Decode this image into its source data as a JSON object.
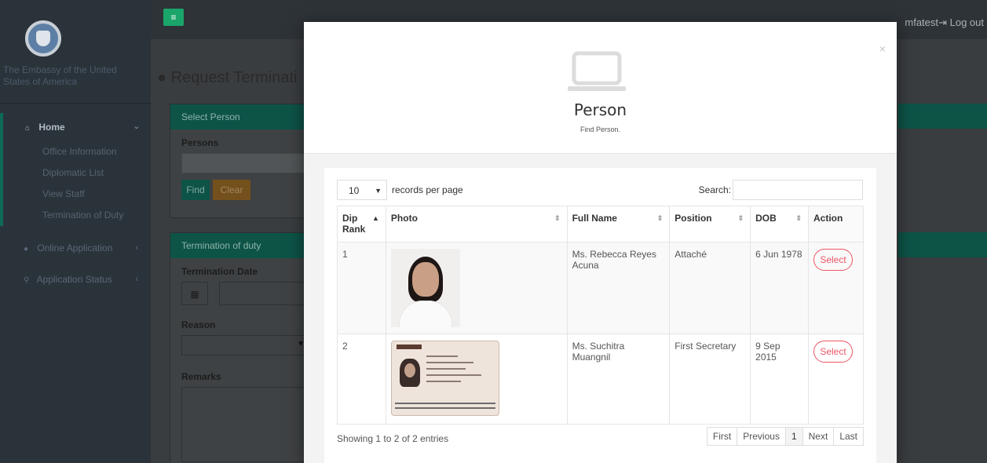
{
  "sidebar": {
    "brand_text": "The Embassy of the United States of America",
    "home_label": "Home",
    "home_items": [
      "Office Information",
      "Diplomatic List",
      "View Staff",
      "Termination of Duty"
    ],
    "online_application": "Online Application",
    "application_status": "Application Status"
  },
  "topbar": {
    "user": "mfatest",
    "logout": "Log out"
  },
  "page": {
    "title": "Request Terminati",
    "select_person_panel": "Select Person",
    "persons_label": "Persons",
    "find_button": "Find",
    "clear_button": "Clear",
    "termination_panel": "Termination of duty",
    "termination_date_label": "Termination Date",
    "reason_label": "Reason",
    "remarks_label": "Remarks"
  },
  "modal": {
    "close": "×",
    "icon": "laptop-icon",
    "title": "Person",
    "subtitle": "Find Person.",
    "length_value": "10",
    "length_suffix": "records per page",
    "search_label": "Search:",
    "columns": [
      "Dip Rank",
      "Photo",
      "Full Name",
      "Position",
      "DOB",
      "Action"
    ],
    "rows": [
      {
        "rank": "1",
        "full_name": "Ms. Rebecca Reyes Acuna",
        "position": "Attaché",
        "dob": "6 Jun 1978",
        "action": "Select"
      },
      {
        "rank": "2",
        "full_name": "Ms. Suchitra Muangnil",
        "position": "First Secretary",
        "dob": "9 Sep 2015",
        "action": "Select"
      }
    ],
    "info": "Showing 1 to 2 of 2 entries",
    "pager": [
      "First",
      "Previous",
      "1",
      "Next",
      "Last"
    ]
  },
  "colors": {
    "accent_green": "#1aa56a",
    "danger": "#ed5565",
    "sidebar_bg": "#2b333a"
  }
}
